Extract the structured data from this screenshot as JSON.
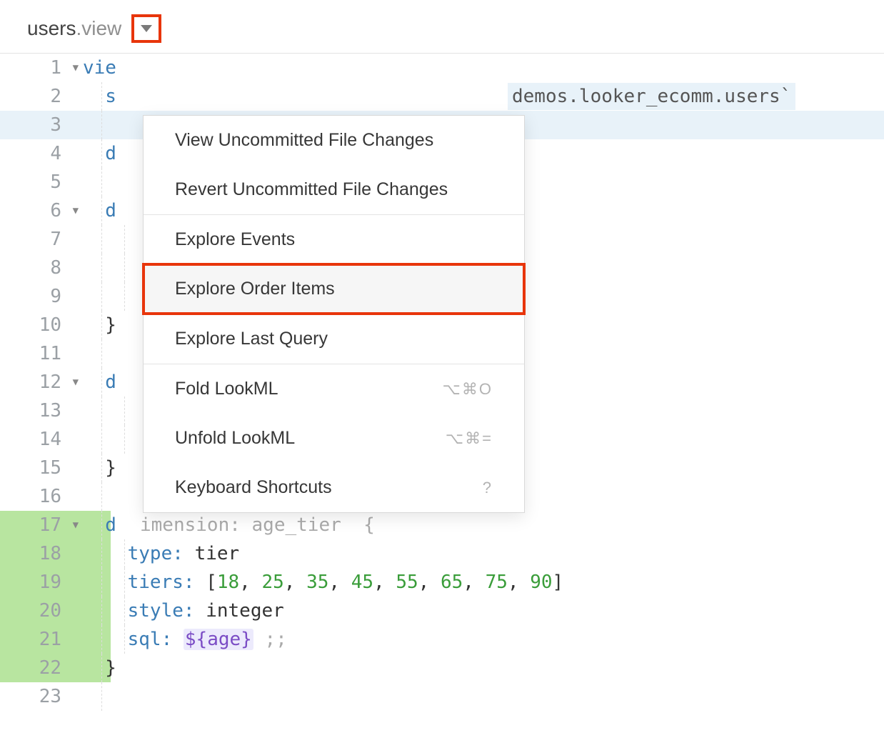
{
  "tab": {
    "filename": "users",
    "extension": ".view"
  },
  "dropdown": {
    "items": [
      {
        "label": "View Uncommitted File Changes",
        "shortcut": ""
      },
      {
        "label": "Revert Uncommitted File Changes",
        "shortcut": ""
      },
      {
        "sep": true
      },
      {
        "label": "Explore Events",
        "shortcut": ""
      },
      {
        "label": "Explore Order Items",
        "shortcut": "",
        "highlight": true
      },
      {
        "sep": true
      },
      {
        "label": "Explore Last Query",
        "shortcut": ""
      },
      {
        "sep": true
      },
      {
        "label": "Fold LookML",
        "shortcut": "⌥⌘O"
      },
      {
        "label": "Unfold LookML",
        "shortcut": "⌥⌘="
      },
      {
        "label": "Keyboard Shortcuts",
        "shortcut": "?"
      }
    ]
  },
  "code": {
    "lines": {
      "1": "vie",
      "2": "  s",
      "2_tail": "demos.looker_ecomm.users`",
      "3": "",
      "4": "  d",
      "5": "",
      "6": "  d",
      "7": "",
      "8": "",
      "9": "",
      "10": "  }",
      "11": "",
      "12": "  d",
      "13": "",
      "14": "",
      "15": "  }",
      "16": "",
      "17": "  d",
      "18_key": "type:",
      "18_val": "tier",
      "19_key": "tiers:",
      "19_open": "[",
      "19_vals": [
        "18",
        "25",
        "35",
        "45",
        "55",
        "65",
        "75",
        "90"
      ],
      "19_close": "]",
      "20_key": "style:",
      "20_val": "integer",
      "21_key": "sql:",
      "21_ref": "${age}",
      "21_tail": ";;",
      "22": "  }",
      "23": ""
    }
  }
}
